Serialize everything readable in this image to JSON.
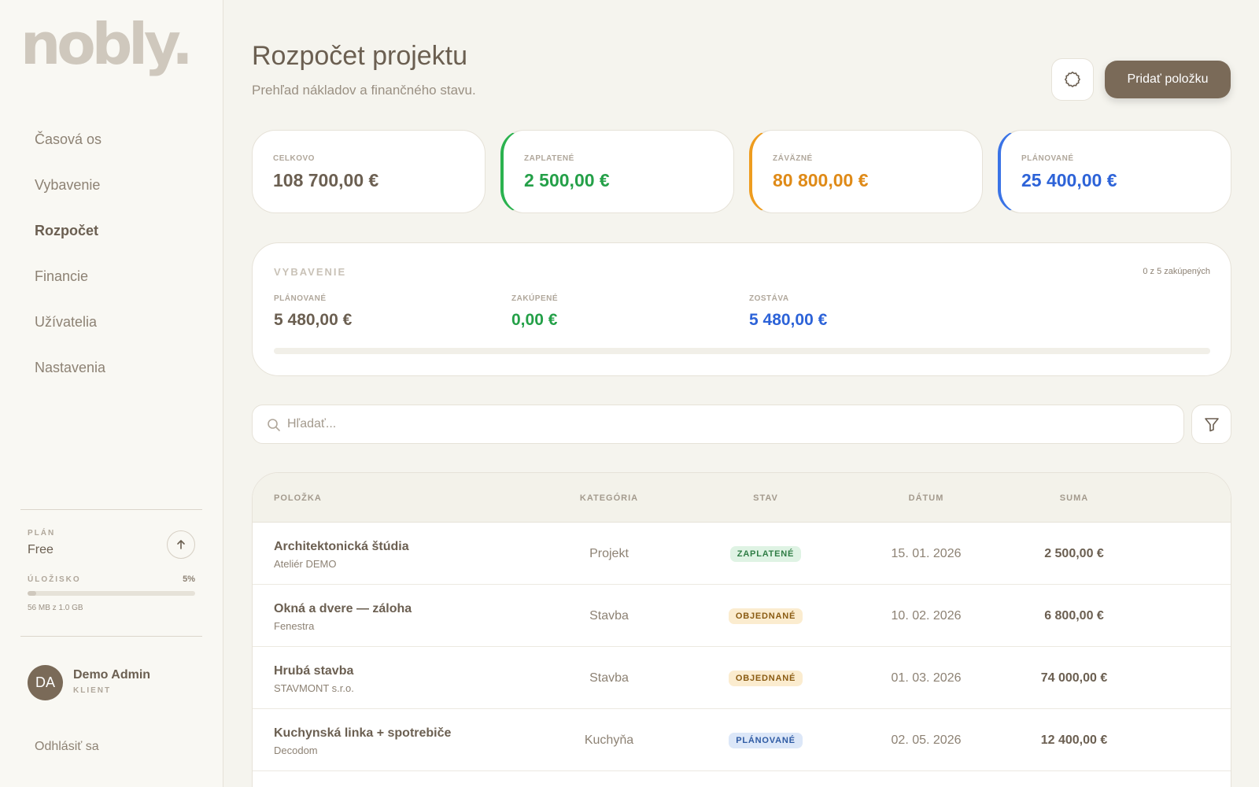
{
  "app": {
    "logo": "nobly."
  },
  "sidebar": {
    "items": [
      {
        "label": "Časová os",
        "active": false
      },
      {
        "label": "Vybavenie",
        "active": false
      },
      {
        "label": "Rozpočet",
        "active": true
      },
      {
        "label": "Financie",
        "active": false
      },
      {
        "label": "Užívatelia",
        "active": false
      },
      {
        "label": "Nastavenia",
        "active": false
      }
    ],
    "plan": {
      "label": "PLÁN",
      "value": "Free"
    },
    "storage": {
      "label": "ÚLOŽISKO",
      "percent_text": "5%",
      "percent": 5,
      "text": "56 MB z 1.0 GB"
    },
    "user": {
      "initials": "DA",
      "name": "Demo Admin",
      "role": "KLIENT"
    },
    "logout": "Odhlásiť sa"
  },
  "header": {
    "title": "Rozpočet projektu",
    "subtitle": "Prehľad nákladov a finančného stavu.",
    "add_button": "Pridať položku"
  },
  "stats": [
    {
      "label": "CELKOVO",
      "value": "108 700,00 €",
      "color": "#6b5f51",
      "accent": ""
    },
    {
      "label": "ZAPLATENÉ",
      "value": "2 500,00 €",
      "color": "#24a048",
      "accent": "#2bb24f"
    },
    {
      "label": "ZÁVÄZNÉ",
      "value": "80 800,00 €",
      "color": "#df8a17",
      "accent": "#ee9c1f"
    },
    {
      "label": "PLÁNOVANÉ",
      "value": "25 400,00 €",
      "color": "#2d63d8",
      "accent": "#3a73e6"
    }
  ],
  "equipment": {
    "title": "VYBAVENIE",
    "count": "0 z 5 zakúpených",
    "planned_label": "PLÁNOVANÉ",
    "planned_value": "5 480,00 €",
    "bought_label": "ZAKÚPENÉ",
    "bought_value": "0,00 €",
    "remaining_label": "ZOSTÁVA",
    "remaining_value": "5 480,00 €",
    "progress": 0
  },
  "search": {
    "placeholder": "Hľadať..."
  },
  "table": {
    "headers": {
      "item": "POLOŽKA",
      "category": "KATEGÓRIA",
      "status": "STAV",
      "date": "DÁTUM",
      "sum": "SUMA"
    },
    "rows": [
      {
        "name": "Architektonická štúdia",
        "vendor": "Ateliér DEMO",
        "category": "Projekt",
        "status": "ZAPLATENÉ",
        "status_kind": "paid",
        "date": "15. 01. 2026",
        "sum": "2 500,00 €"
      },
      {
        "name": "Okná a dvere — záloha",
        "vendor": "Fenestra",
        "category": "Stavba",
        "status": "OBJEDNANÉ",
        "status_kind": "ordered",
        "date": "10. 02. 2026",
        "sum": "6 800,00 €"
      },
      {
        "name": "Hrubá stavba",
        "vendor": "STAVMONT s.r.o.",
        "category": "Stavba",
        "status": "OBJEDNANÉ",
        "status_kind": "ordered",
        "date": "01. 03. 2026",
        "sum": "74 000,00 €"
      },
      {
        "name": "Kuchynská linka + spotrebiče",
        "vendor": "Decodom",
        "category": "Kuchyňa",
        "status": "PLÁNOVANÉ",
        "status_kind": "planned",
        "date": "02. 05. 2026",
        "sum": "12 400,00 €"
      }
    ]
  }
}
